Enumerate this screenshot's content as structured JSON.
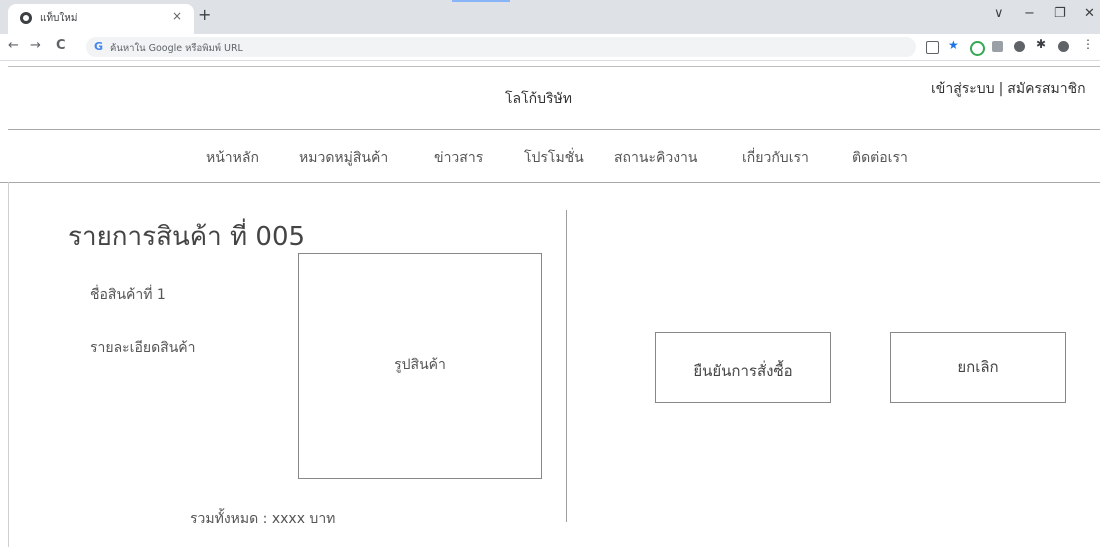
{
  "browser": {
    "tab_title": "แท็บใหม่",
    "tab_close": "×",
    "new_tab": "+",
    "back": "←",
    "forward": "→",
    "reload": "C",
    "omnibox_icon": "G",
    "omnibox_placeholder": "ค้นหาใน Google หรือพิมพ์ URL",
    "window_controls": {
      "menu": "∨",
      "minimize": "−",
      "restore": "❐",
      "close": "✕"
    },
    "extension_colors": [
      "#5f6368",
      "#1a73e8",
      "#34a853",
      "#9aa0a6",
      "#5f6368",
      "#3c4043",
      "#5f6368"
    ]
  },
  "header": {
    "logo": "โลโก้บริษัท",
    "login": "เข้าสู่ระบบ",
    "separator": "|",
    "register": "สมัครสมาชิก"
  },
  "nav": {
    "items": [
      "หน้าหลัก",
      "หมวดหมู่สินค้า",
      "ข่าวสาร",
      "โปรโมชั่น",
      "สถานะคิวงาน",
      "เกี่ยวกับเรา",
      "ติดต่อเรา"
    ]
  },
  "product": {
    "title": "รายการสินค้า ที่ 005",
    "name": "ชื่อสินค้าที่ 1",
    "detail": "รายละเอียดสินค้า",
    "image_label": "รูปสินค้า",
    "total": "รวมทั้งหมด : xxxx บาท"
  },
  "actions": {
    "confirm": "ยืนยันการสั่งซื้อ",
    "cancel": "ยกเลิก"
  }
}
